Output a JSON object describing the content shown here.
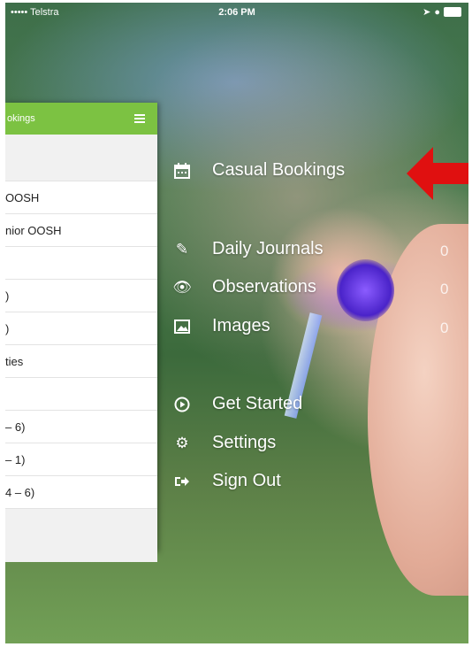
{
  "status_bar": {
    "carrier": "••••• Telstra",
    "time": "2:06 PM"
  },
  "side_panel": {
    "header_title": "okings",
    "rows": [
      {
        "label": "",
        "section": true
      },
      {
        "label": "OOSH"
      },
      {
        "label": "nior OOSH"
      },
      {
        "label": ""
      },
      {
        "label": ")"
      },
      {
        "label": ")"
      },
      {
        "label": "ties"
      },
      {
        "label": ""
      },
      {
        "label": "– 6)"
      },
      {
        "label": "– 1)"
      },
      {
        "label": "4 – 6)"
      }
    ]
  },
  "menu": {
    "casual_bookings": "Casual Bookings",
    "daily_journals": "Daily Journals",
    "daily_journals_count": "0",
    "observations": "Observations",
    "observations_count": "0",
    "images": "Images",
    "images_count": "0",
    "get_started": "Get Started",
    "settings": "Settings",
    "sign_out": "Sign Out"
  },
  "colors": {
    "header_green": "#7cc242",
    "arrow_red": "#e01010"
  }
}
